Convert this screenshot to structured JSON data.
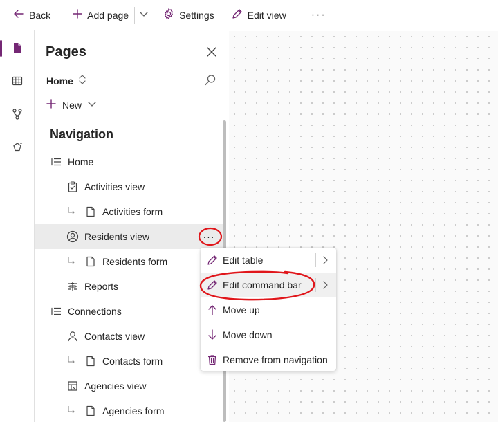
{
  "toolbar": {
    "back_label": "Back",
    "add_page_label": "Add page",
    "settings_label": "Settings",
    "edit_view_label": "Edit view",
    "more_label": "···"
  },
  "rail": {
    "items": [
      {
        "icon": "page-icon",
        "active": true
      },
      {
        "icon": "table-icon",
        "active": false
      },
      {
        "icon": "flow-icon",
        "active": false
      },
      {
        "icon": "ai-icon",
        "active": false
      }
    ]
  },
  "panel": {
    "title": "Pages",
    "home_selector": "Home",
    "new_label": "New",
    "navigation_heading": "Navigation",
    "row_more": "···",
    "items": [
      {
        "label": "Home",
        "icon": "list-icon",
        "level": 0
      },
      {
        "label": "Activities view",
        "icon": "clipboard-icon",
        "level": 1
      },
      {
        "label": "Activities form",
        "icon": "form-icon",
        "level": 2
      },
      {
        "label": "Residents view",
        "icon": "person-circle-icon",
        "level": 1,
        "selected": true
      },
      {
        "label": "Residents form",
        "icon": "form-icon",
        "level": 2
      },
      {
        "label": "Reports",
        "icon": "reports-icon",
        "level": 1
      },
      {
        "label": "Connections",
        "icon": "list-icon",
        "level": 0
      },
      {
        "label": "Contacts view",
        "icon": "person-icon",
        "level": 1
      },
      {
        "label": "Contacts form",
        "icon": "form-icon",
        "level": 2
      },
      {
        "label": "Agencies view",
        "icon": "agency-icon",
        "level": 1
      },
      {
        "label": "Agencies form",
        "icon": "form-icon",
        "level": 2
      }
    ]
  },
  "context_menu": {
    "items": [
      {
        "label": "Edit table",
        "icon": "pencil-icon",
        "has_submenu": true
      },
      {
        "label": "Edit command bar",
        "icon": "pencil-icon",
        "has_submenu": true,
        "hovered": true
      },
      {
        "label": "Move up",
        "icon": "arrow-up-icon",
        "has_submenu": false
      },
      {
        "label": "Move down",
        "icon": "arrow-down-icon",
        "has_submenu": false
      },
      {
        "label": "Remove from navigation",
        "icon": "trash-icon",
        "has_submenu": false
      }
    ]
  },
  "colors": {
    "accent": "#742774",
    "annotation": "#e0161b",
    "selected_row": "#ebebeb"
  }
}
